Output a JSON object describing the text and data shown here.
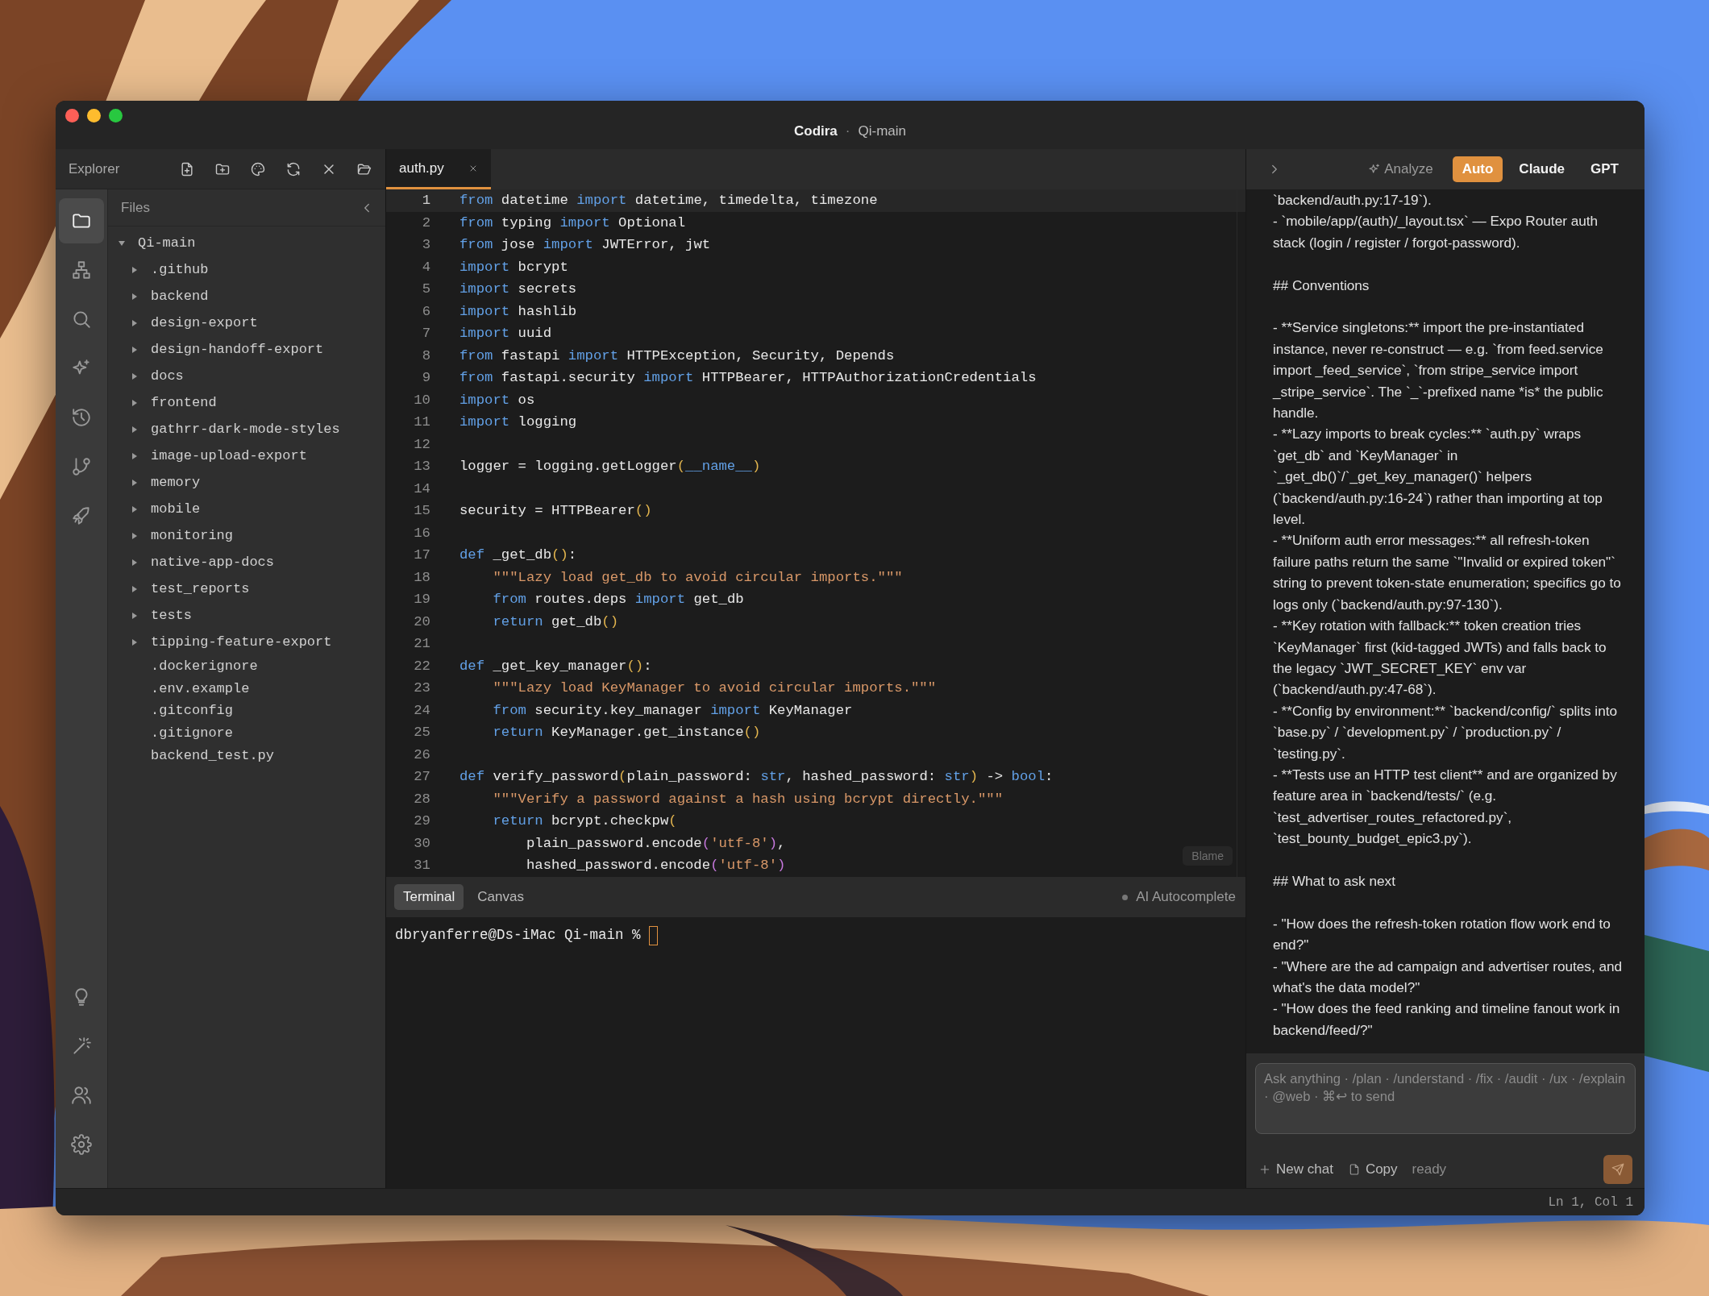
{
  "window": {
    "app": "Codira",
    "separator": "·",
    "project": "Qi-main"
  },
  "explorer": {
    "title": "Explorer"
  },
  "activity_bar": {
    "items": [
      {
        "selected": true
      },
      {
        "selected": false
      },
      {
        "selected": false
      },
      {
        "selected": false
      },
      {
        "selected": false
      },
      {
        "selected": false
      },
      {
        "selected": false
      }
    ]
  },
  "files": {
    "title": "Files",
    "tree": [
      {
        "name": "Qi-main",
        "kind": "folder",
        "expanded": true,
        "children": [
          {
            "name": ".github",
            "kind": "folder",
            "expanded": false
          },
          {
            "name": "backend",
            "kind": "folder",
            "expanded": false
          },
          {
            "name": "design-export",
            "kind": "folder",
            "expanded": false
          },
          {
            "name": "design-handoff-export",
            "kind": "folder",
            "expanded": false
          },
          {
            "name": "docs",
            "kind": "folder",
            "expanded": false
          },
          {
            "name": "frontend",
            "kind": "folder",
            "expanded": false
          },
          {
            "name": "gathrr-dark-mode-styles",
            "kind": "folder",
            "expanded": false
          },
          {
            "name": "image-upload-export",
            "kind": "folder",
            "expanded": false
          },
          {
            "name": "memory",
            "kind": "folder",
            "expanded": false
          },
          {
            "name": "mobile",
            "kind": "folder",
            "expanded": false
          },
          {
            "name": "monitoring",
            "kind": "folder",
            "expanded": false
          },
          {
            "name": "native-app-docs",
            "kind": "folder",
            "expanded": false
          },
          {
            "name": "test_reports",
            "kind": "folder",
            "expanded": false
          },
          {
            "name": "tests",
            "kind": "folder",
            "expanded": false
          },
          {
            "name": "tipping-feature-export",
            "kind": "folder",
            "expanded": false
          },
          {
            "name": ".dockerignore",
            "kind": "file"
          },
          {
            "name": ".env.example",
            "kind": "file"
          },
          {
            "name": ".gitconfig",
            "kind": "file"
          },
          {
            "name": ".gitignore",
            "kind": "file"
          },
          {
            "name": "backend_test.py",
            "kind": "file"
          }
        ]
      }
    ]
  },
  "editor": {
    "tabs": [
      {
        "label": "auth.py",
        "selected": true
      }
    ],
    "blame": "Blame",
    "lines": [
      {
        "number": "1",
        "current": true,
        "tokens": [
          {
            "kind": "kw",
            "text": "from"
          },
          {
            "kind": "text",
            "text": " datetime "
          },
          {
            "kind": "kw",
            "text": "import"
          },
          {
            "kind": "text",
            "text": " datetime, timedelta, timezone"
          }
        ]
      },
      {
        "number": "2",
        "current": false,
        "tokens": [
          {
            "kind": "kw",
            "text": "from"
          },
          {
            "kind": "text",
            "text": " typing "
          },
          {
            "kind": "kw",
            "text": "import"
          },
          {
            "kind": "text",
            "text": " Optional"
          }
        ]
      },
      {
        "number": "3",
        "current": false,
        "tokens": [
          {
            "kind": "kw",
            "text": "from"
          },
          {
            "kind": "text",
            "text": " jose "
          },
          {
            "kind": "kw",
            "text": "import"
          },
          {
            "kind": "text",
            "text": " JWTError, jwt"
          }
        ]
      },
      {
        "number": "4",
        "current": false,
        "tokens": [
          {
            "kind": "kw",
            "text": "import"
          },
          {
            "kind": "text",
            "text": " bcrypt"
          }
        ]
      },
      {
        "number": "5",
        "current": false,
        "tokens": [
          {
            "kind": "kw",
            "text": "import"
          },
          {
            "kind": "text",
            "text": " secrets"
          }
        ]
      },
      {
        "number": "6",
        "current": false,
        "tokens": [
          {
            "kind": "kw",
            "text": "import"
          },
          {
            "kind": "text",
            "text": " hashlib"
          }
        ]
      },
      {
        "number": "7",
        "current": false,
        "tokens": [
          {
            "kind": "kw",
            "text": "import"
          },
          {
            "kind": "text",
            "text": " uuid"
          }
        ]
      },
      {
        "number": "8",
        "current": false,
        "tokens": [
          {
            "kind": "kw",
            "text": "from"
          },
          {
            "kind": "text",
            "text": " fastapi "
          },
          {
            "kind": "kw",
            "text": "import"
          },
          {
            "kind": "text",
            "text": " HTTPException, Security, Depends"
          }
        ]
      },
      {
        "number": "9",
        "current": false,
        "tokens": [
          {
            "kind": "kw",
            "text": "from"
          },
          {
            "kind": "text",
            "text": " fastapi.security "
          },
          {
            "kind": "kw",
            "text": "import"
          },
          {
            "kind": "text",
            "text": " HTTPBearer, HTTPAuthorizationCredentials"
          }
        ]
      },
      {
        "number": "10",
        "current": false,
        "tokens": [
          {
            "kind": "kw",
            "text": "import"
          },
          {
            "kind": "text",
            "text": " os"
          }
        ]
      },
      {
        "number": "11",
        "current": false,
        "tokens": [
          {
            "kind": "kw",
            "text": "import"
          },
          {
            "kind": "text",
            "text": " logging"
          }
        ]
      },
      {
        "number": "12",
        "current": false
      },
      {
        "number": "13",
        "current": false,
        "tokens": [
          {
            "kind": "text",
            "text": "logger = logging.getLogger"
          },
          {
            "kind": "bracket",
            "text": "("
          },
          {
            "kind": "kw",
            "text": "__name__"
          },
          {
            "kind": "bracket",
            "text": ")"
          }
        ]
      },
      {
        "number": "14",
        "current": false
      },
      {
        "number": "15",
        "current": false,
        "tokens": [
          {
            "kind": "text",
            "text": "security = HTTPBearer"
          },
          {
            "kind": "bracket",
            "text": "()"
          }
        ]
      },
      {
        "number": "16",
        "current": false
      },
      {
        "number": "17",
        "current": false,
        "tokens": [
          {
            "kind": "kw",
            "text": "def"
          },
          {
            "kind": "text",
            "text": " _get_db"
          },
          {
            "kind": "bracket",
            "text": "()"
          },
          {
            "kind": "text",
            "text": ":"
          }
        ]
      },
      {
        "number": "18",
        "current": false,
        "tokens": [
          {
            "kind": "str",
            "text": "    \"\"\"Lazy load get_db to avoid circular imports.\"\"\""
          }
        ]
      },
      {
        "number": "19",
        "current": false,
        "tokens": [
          {
            "kind": "kw",
            "text": "    from"
          },
          {
            "kind": "text",
            "text": " routes.deps "
          },
          {
            "kind": "kw",
            "text": "import"
          },
          {
            "kind": "text",
            "text": " get_db"
          }
        ]
      },
      {
        "number": "20",
        "current": false,
        "tokens": [
          {
            "kind": "kw",
            "text": "    return"
          },
          {
            "kind": "text",
            "text": " get_db"
          },
          {
            "kind": "bracket",
            "text": "()"
          }
        ]
      },
      {
        "number": "21",
        "current": false
      },
      {
        "number": "22",
        "current": false,
        "tokens": [
          {
            "kind": "kw",
            "text": "def"
          },
          {
            "kind": "text",
            "text": " _get_key_manager"
          },
          {
            "kind": "bracket",
            "text": "()"
          },
          {
            "kind": "text",
            "text": ":"
          }
        ]
      },
      {
        "number": "23",
        "current": false,
        "tokens": [
          {
            "kind": "str",
            "text": "    \"\"\"Lazy load KeyManager to avoid circular imports.\"\"\""
          }
        ]
      },
      {
        "number": "24",
        "current": false,
        "tokens": [
          {
            "kind": "kw",
            "text": "    from"
          },
          {
            "kind": "text",
            "text": " security.key_manager "
          },
          {
            "kind": "kw",
            "text": "import"
          },
          {
            "kind": "text",
            "text": " KeyManager"
          }
        ]
      },
      {
        "number": "25",
        "current": false,
        "tokens": [
          {
            "kind": "kw",
            "text": "    return"
          },
          {
            "kind": "text",
            "text": " KeyManager.get_instance"
          },
          {
            "kind": "bracket",
            "text": "()"
          }
        ]
      },
      {
        "number": "26",
        "current": false
      },
      {
        "number": "27",
        "current": false,
        "tokens": [
          {
            "kind": "kw",
            "text": "def"
          },
          {
            "kind": "text",
            "text": " verify_password"
          },
          {
            "kind": "bracket",
            "text": "("
          },
          {
            "kind": "text",
            "text": "plain_password: "
          },
          {
            "kind": "kw",
            "text": "str"
          },
          {
            "kind": "text",
            "text": ", hashed_password: "
          },
          {
            "kind": "kw",
            "text": "str"
          },
          {
            "kind": "bracket",
            "text": ")"
          },
          {
            "kind": "text",
            "text": " -> "
          },
          {
            "kind": "kw",
            "text": "bool"
          },
          {
            "kind": "text",
            "text": ":"
          }
        ]
      },
      {
        "number": "28",
        "current": false,
        "tokens": [
          {
            "kind": "str",
            "text": "    \"\"\"Verify a password against a hash using bcrypt directly.\"\"\""
          }
        ]
      },
      {
        "number": "29",
        "current": false,
        "tokens": [
          {
            "kind": "kw",
            "text": "    return"
          },
          {
            "kind": "text",
            "text": " bcrypt.checkpw"
          },
          {
            "kind": "bracket",
            "text": "("
          }
        ]
      },
      {
        "number": "30",
        "current": false,
        "tokens": [
          {
            "kind": "text",
            "text": "        plain_password.encode"
          },
          {
            "kind": "bracket2",
            "text": "("
          },
          {
            "kind": "str",
            "text": "'utf-8'"
          },
          {
            "kind": "bracket2",
            "text": ")"
          },
          {
            "kind": "text",
            "text": ","
          }
        ]
      },
      {
        "number": "31",
        "current": false,
        "tokens": [
          {
            "kind": "text",
            "text": "        hashed_password.encode"
          },
          {
            "kind": "bracket2",
            "text": "("
          },
          {
            "kind": "str",
            "text": "'utf-8'"
          },
          {
            "kind": "bracket2",
            "text": ")"
          }
        ]
      }
    ]
  },
  "panel": {
    "tabs": [
      {
        "label": "Terminal",
        "selected": true
      },
      {
        "label": "Canvas",
        "selected": false
      }
    ],
    "status": "AI Autocomplete",
    "prompt": "dbryanferre@Ds-iMac Qi-main % "
  },
  "assistant": {
    "analyze": "Analyze",
    "models": [
      {
        "label": "Auto",
        "selected": true
      },
      {
        "label": "Claude",
        "selected": false
      },
      {
        "label": "GPT",
        "selected": false
      }
    ],
    "blocks": [
      [
        "`backend/auth.py:17-19`).",
        "- `mobile/app/(auth)/_layout.tsx` — Expo Router auth stack (login / register / forgot-password)."
      ],
      [
        "## Conventions"
      ],
      [
        "- **Service singletons:** import the pre-instantiated instance, never re-construct — e.g. `from feed.service import _feed_service`, `from stripe_service import _stripe_service`. The `_`-prefixed name *is* the public handle.",
        "- **Lazy imports to break cycles:** `auth.py` wraps `get_db` and `KeyManager` in `_get_db()`/`_get_key_manager()` helpers (`backend/auth.py:16-24`) rather than importing at top level.",
        "- **Uniform auth error messages:** all refresh-token failure paths return the same `\"Invalid or expired token\"` string to prevent token-state enumeration; specifics go to logs only (`backend/auth.py:97-130`).",
        "- **Key rotation with fallback:** token creation tries `KeyManager` first (kid-tagged JWTs) and falls back to the legacy `JWT_SECRET_KEY` env var (`backend/auth.py:47-68`).",
        "- **Config by environment:** `backend/config/` splits into `base.py` / `development.py` / `production.py` / `testing.py`.",
        "- **Tests use an HTTP test client** and are organized by feature area in `backend/tests/` (e.g. `test_advertiser_routes_refactored.py`, `test_bounty_budget_epic3.py`)."
      ],
      [
        "## What to ask next"
      ],
      [
        "- \"How does the refresh-token rotation flow work end to end?\"",
        "- \"Where are the ad campaign and advertiser routes, and what's the data model?\"",
        "- \"How does the feed ranking and timeline fanout work in backend/feed/?\""
      ]
    ],
    "input": {
      "placeholder": "Ask anything · /plan · /understand · /fix · /audit · /ux · /explain · @web · ⌘↩ to send"
    },
    "actions": {
      "new_chat": "New chat",
      "copy": "Copy",
      "state": "ready"
    }
  },
  "status_bar": {
    "position": "Ln 1, Col 1"
  }
}
